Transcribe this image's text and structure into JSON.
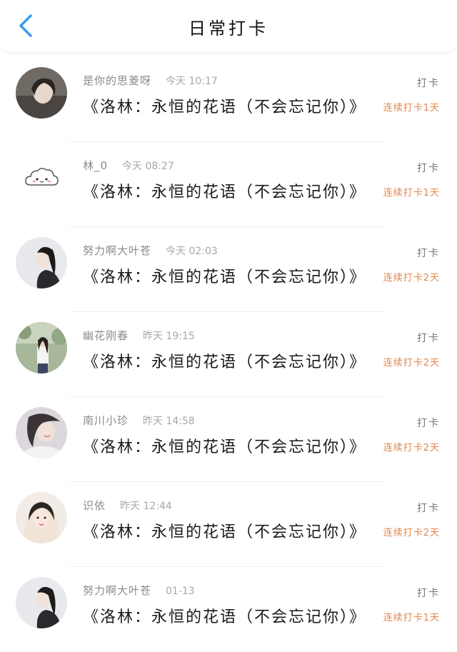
{
  "header": {
    "title": "日常打卡"
  },
  "entries": [
    {
      "name": "是你的思菱呀",
      "time": "今天 10:17",
      "book": "《洛林：永恒的花语（不会忘记你）》",
      "checkin": "打卡",
      "streak": "连续打卡1天",
      "avatar": "woman-photo"
    },
    {
      "name": "林_0",
      "time": "今天 08:27",
      "book": "《洛林：永恒的花语（不会忘记你）》",
      "checkin": "打卡",
      "streak": "连续打卡1天",
      "avatar": "cloud-cartoon"
    },
    {
      "name": "努力啊大叶苍",
      "time": "今天 02:03",
      "book": "《洛林：永恒的花语（不会忘记你）》",
      "checkin": "打卡",
      "streak": "连续打卡2天",
      "avatar": "woman-photo"
    },
    {
      "name": "幽花刚春",
      "time": "昨天 19:15",
      "book": "《洛林：永恒的花语（不会忘记你）》",
      "checkin": "打卡",
      "streak": "连续打卡2天",
      "avatar": "outdoor-photo"
    },
    {
      "name": "南川小珍",
      "time": "昨天 14:58",
      "book": "《洛林：永恒的花语（不会忘记你）》",
      "checkin": "打卡",
      "streak": "连续打卡2天",
      "avatar": "woman-photo"
    },
    {
      "name": "识依",
      "time": "昨天 12:44",
      "book": "《洛林：永恒的花语（不会忘记你）》",
      "checkin": "打卡",
      "streak": "连续打卡2天",
      "avatar": "anime-girl"
    },
    {
      "name": "努力啊大叶苍",
      "time": "01-13",
      "book": "《洛林：永恒的花语（不会忘记你）》",
      "checkin": "打卡",
      "streak": "连续打卡1天",
      "avatar": "woman-photo"
    }
  ],
  "colors": {
    "back_arrow": "#3a9bf0",
    "streak": "#e2874a",
    "meta": "#8a8a8a"
  }
}
